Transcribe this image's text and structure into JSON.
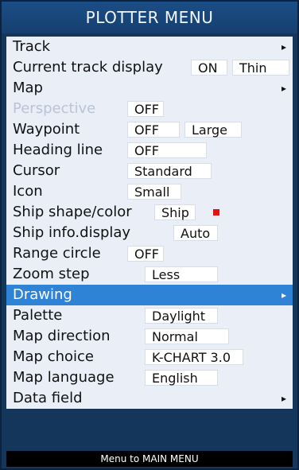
{
  "menu": {
    "title": "PLOTTER MENU",
    "footer_text": "Menu to MAIN MENU",
    "items": [
      {
        "label": "Track"
      },
      {
        "label": "Current track display",
        "value1": "ON",
        "value2": "Thin"
      },
      {
        "label": "Map"
      },
      {
        "label": "Perspective",
        "value1": "OFF"
      },
      {
        "label": "Waypoint",
        "value1": "OFF",
        "value2": "Large"
      },
      {
        "label": "Heading line",
        "value1": "OFF"
      },
      {
        "label": "Cursor",
        "value1": "Standard"
      },
      {
        "label": "Icon",
        "value1": "Small"
      },
      {
        "label": "Ship shape/color",
        "value1": "Ship"
      },
      {
        "label": "Ship info.display",
        "value1": "Auto"
      },
      {
        "label": "Range circle",
        "value1": "OFF"
      },
      {
        "label": "Zoom step",
        "value1": "Less"
      },
      {
        "label": "Drawing"
      },
      {
        "label": "Palette",
        "value1": "Daylight"
      },
      {
        "label": "Map direction",
        "value1": "Normal"
      },
      {
        "label": "Map choice",
        "value1": "K-CHART 3.0"
      },
      {
        "label": "Map language",
        "value1": "English"
      },
      {
        "label": "Data field"
      }
    ]
  },
  "colors": {
    "ship_color": "#e11212",
    "selected_row": "#2e83d6"
  },
  "icons": {
    "submenu_arrow": "▸"
  }
}
